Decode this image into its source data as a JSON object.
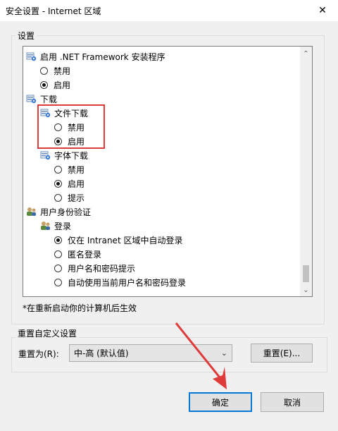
{
  "window": {
    "title": "安全设置 - Internet 区域",
    "close_glyph": "✕"
  },
  "settings_group": {
    "label": "设置"
  },
  "tree": [
    {
      "type": "folder",
      "label": "启用 .NET Framework 安装程序",
      "icon": "settings-folder-icon"
    },
    {
      "type": "radio",
      "label": "禁用",
      "checked": false
    },
    {
      "type": "radio",
      "label": "启用",
      "checked": true
    },
    {
      "type": "folder",
      "label": "下载",
      "icon": "settings-folder-icon"
    },
    {
      "type": "folder",
      "label": "文件下载",
      "icon": "settings-folder-icon"
    },
    {
      "type": "radio",
      "label": "禁用",
      "checked": false
    },
    {
      "type": "radio",
      "label": "启用",
      "checked": true
    },
    {
      "type": "folder",
      "label": "字体下载",
      "icon": "settings-folder-icon"
    },
    {
      "type": "radio",
      "label": "禁用",
      "checked": false
    },
    {
      "type": "radio",
      "label": "启用",
      "checked": true
    },
    {
      "type": "radio",
      "label": "提示",
      "checked": false
    },
    {
      "type": "folder",
      "label": "用户身份验证",
      "icon": "users-icon"
    },
    {
      "type": "folder",
      "label": "登录",
      "icon": "users-icon"
    },
    {
      "type": "radio",
      "label": "仅在 Intranet 区域中自动登录",
      "checked": true
    },
    {
      "type": "radio",
      "label": "匿名登录",
      "checked": false
    },
    {
      "type": "radio",
      "label": "用户名和密码提示",
      "checked": false
    },
    {
      "type": "radio",
      "label": "自动使用当前用户名和密码登录",
      "checked": false
    }
  ],
  "note": "*在重新启动你的计算机后生效",
  "reset_group": {
    "label": "重置自定义设置",
    "reset_to_label": "重置为(R):",
    "selected": "中-高 (默认值)",
    "reset_button": "重置(E)..."
  },
  "buttons": {
    "ok": "确定",
    "cancel": "取消"
  },
  "colors": {
    "highlight": "#e03b3b",
    "default_button_border": "#0078d7"
  }
}
